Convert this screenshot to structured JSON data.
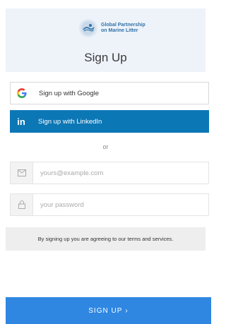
{
  "header": {
    "logo": {
      "line1": "Global Partnership",
      "line2": "on Marine Litter"
    },
    "title": "Sign Up"
  },
  "social": {
    "google_label": "Sign up with Google",
    "linkedin_label": "Sign up with LinkedIn",
    "linkedin_icon_text": "in"
  },
  "divider_text": "or",
  "form": {
    "email_placeholder": "yours@example.com",
    "email_value": "",
    "password_placeholder": "your password",
    "password_value": ""
  },
  "terms_text": "By signing up you are agreeing to our terms and services.",
  "submit": {
    "label": "SIGN UP",
    "chevron": "›"
  },
  "colors": {
    "header_bg": "#eef3fa",
    "linkedin": "#0c77b5",
    "submit": "#2f87e2",
    "logo_text": "#2f72a8"
  }
}
